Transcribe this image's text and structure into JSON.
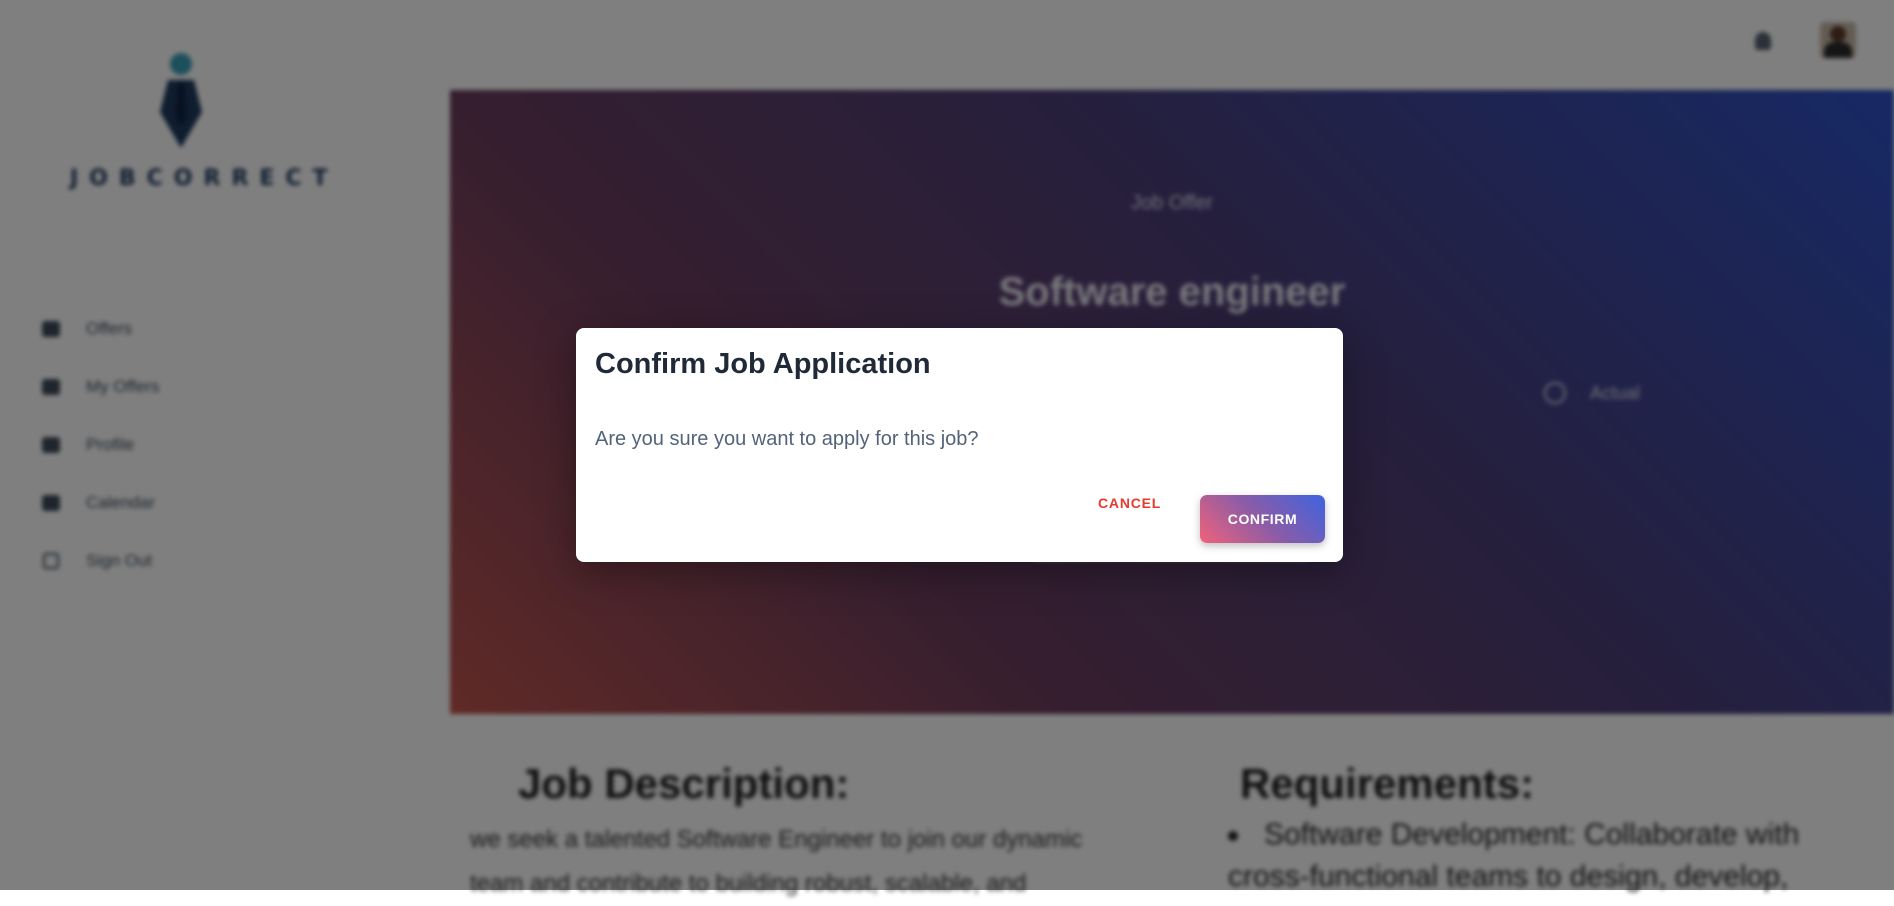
{
  "brand": {
    "logo_text": "JOBCORRECT"
  },
  "sidebar": {
    "items": [
      {
        "label": "Offers",
        "icon": "briefcase-icon"
      },
      {
        "label": "My Offers",
        "icon": "list-icon"
      },
      {
        "label": "Profile",
        "icon": "user-card-icon"
      },
      {
        "label": "Calendar",
        "icon": "calendar-icon"
      },
      {
        "label": "Sign Out",
        "icon": "sign-out-icon"
      }
    ]
  },
  "topbar": {
    "notification_icon": "bell-icon",
    "avatar_icon": "user-avatar"
  },
  "hero": {
    "subtitle": "Job Offer",
    "title": "Software engineer",
    "location": "Actual"
  },
  "content": {
    "description_heading": "Job Description:",
    "description_text_1": "we seek a talented Software Engineer to join our dynamic",
    "description_text_2": "team and contribute to building robust, scalable, and",
    "requirements_heading": "Requirements:",
    "requirement_1_line_1": "Software Development: Collaborate with",
    "requirement_1_line_2": "cross-functional teams to design, develop,"
  },
  "dialog": {
    "title": "Confirm Job Application",
    "message": "Are you sure you want to apply for this job?",
    "cancel_label": "CANCEL",
    "confirm_label": "CONFIRM"
  },
  "colors": {
    "cancel": "#e63c2e",
    "confirm_gradient_start": "#f0627a",
    "confirm_gradient_end": "#3e63e0",
    "hero_gradient_start": "#2d52c9",
    "hero_gradient_end": "#c0544d"
  }
}
